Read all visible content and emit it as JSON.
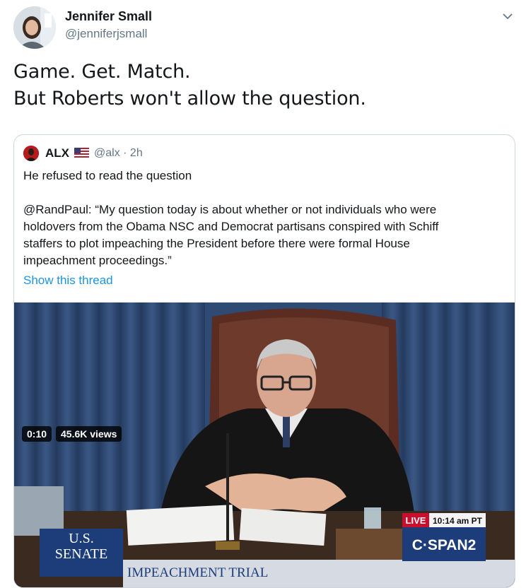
{
  "tweet": {
    "author_name": "Jennifer Small",
    "author_handle": "@jenniferjsmall",
    "text_lines": [
      "Game. Get. Match.",
      "But Roberts won't allow the question."
    ]
  },
  "quoted": {
    "name": "ALX",
    "flag": "us-flag-icon",
    "handle_time": "@alx · 2h",
    "line1": "He refused to read the question",
    "paragraph_lines": [
      "@RandPaul: “My question today is about whether or not individuals who were",
      "holdovers from the Obama NSC and Democrat partisans conspired with Schiff",
      "staffers to plot impeaching the President before there were formal House",
      "impeachment proceedings.”"
    ],
    "show_thread": "Show this thread"
  },
  "video": {
    "live_label": "LIVE",
    "live_time": "10:14 am PT",
    "channel": "C·SPAN2",
    "senate_line1": "U.S.",
    "senate_line2": "SENATE",
    "lower_third": "IMPEACHMENT TRIAL",
    "duration": "0:10",
    "views": "45.6K views"
  },
  "colors": {
    "link": "#1b95e0",
    "secondary": "#657786",
    "border": "#ccd6dd",
    "live_red": "#c8102e",
    "senate_blue": "#1d3d7a"
  }
}
